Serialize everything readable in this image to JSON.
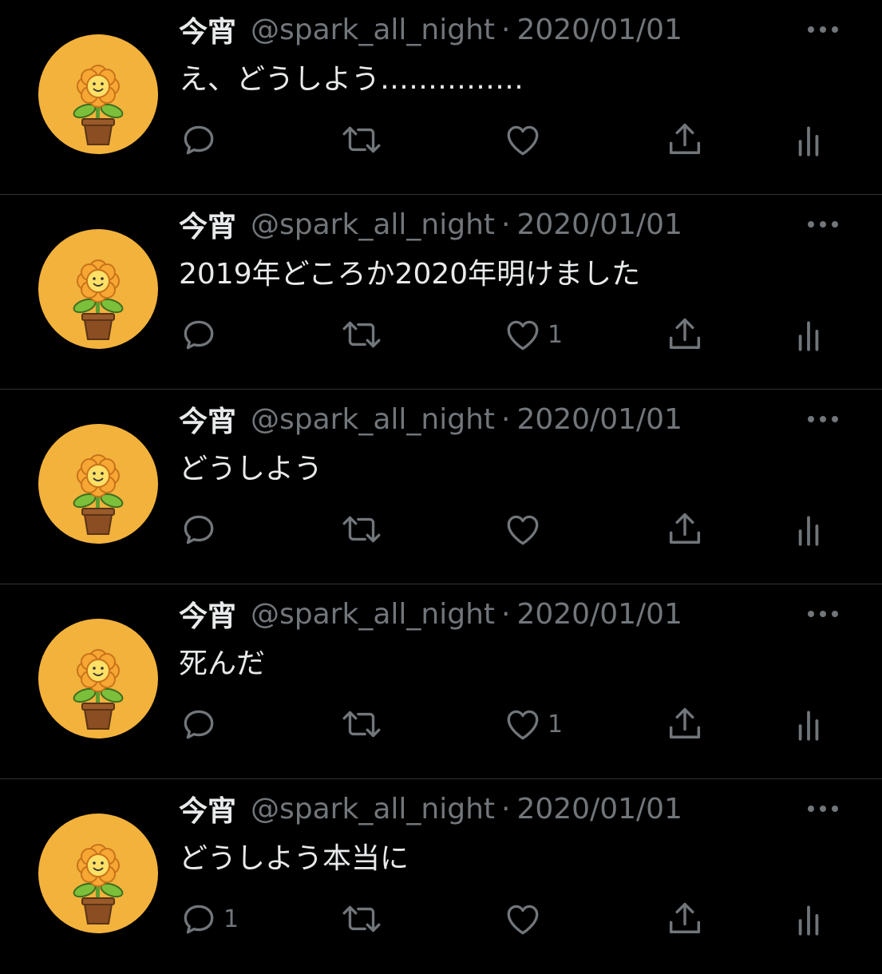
{
  "colors": {
    "background": "#000000",
    "text": "#e7e9ea",
    "secondary": "#71767b",
    "divider": "#2f3336",
    "avatar_bg": "#f2b23c"
  },
  "icons": [
    "more-icon",
    "reply-icon",
    "retweet-icon",
    "like-icon",
    "share-icon",
    "views-icon"
  ],
  "tweets": [
    {
      "name": "今宵",
      "handle": "@spark_all_night",
      "sep": "·",
      "date": "2020/01/01",
      "text": "え、どうしよう……………",
      "reply_count": "",
      "like_count": ""
    },
    {
      "name": "今宵",
      "handle": "@spark_all_night",
      "sep": "·",
      "date": "2020/01/01",
      "text": "2019年どころか2020年明けました",
      "reply_count": "",
      "like_count": "1"
    },
    {
      "name": "今宵",
      "handle": "@spark_all_night",
      "sep": "·",
      "date": "2020/01/01",
      "text": "どうしよう",
      "reply_count": "",
      "like_count": ""
    },
    {
      "name": "今宵",
      "handle": "@spark_all_night",
      "sep": "·",
      "date": "2020/01/01",
      "text": "死んだ",
      "reply_count": "",
      "like_count": "1"
    },
    {
      "name": "今宵",
      "handle": "@spark_all_night",
      "sep": "·",
      "date": "2020/01/01",
      "text": "どうしよう本当に",
      "reply_count": "1",
      "like_count": ""
    }
  ]
}
